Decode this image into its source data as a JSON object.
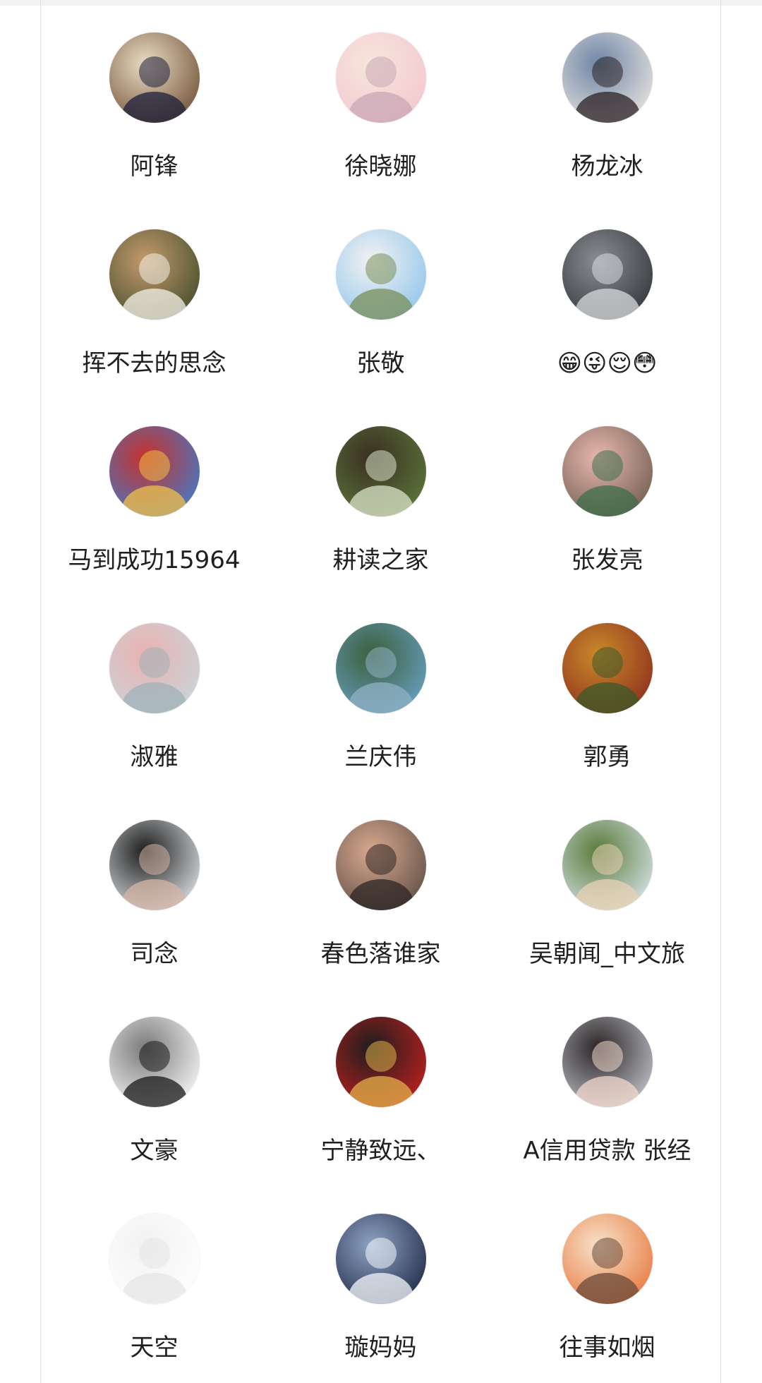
{
  "members": [
    {
      "name": "阿锋",
      "avatar_colors": [
        "#6b4a2e",
        "#e9dcc5",
        "#1d1f3b"
      ]
    },
    {
      "name": "徐晓娜",
      "avatar_colors": [
        "#f2c6cf",
        "#f7e6dc",
        "#c9a7b5"
      ]
    },
    {
      "name": "杨龙冰",
      "avatar_colors": [
        "#efe8e2",
        "#6e86a6",
        "#2c2226"
      ]
    },
    {
      "name": "挥不去的思念",
      "avatar_colors": [
        "#3e4a2a",
        "#c49a6c",
        "#f4f1e8"
      ]
    },
    {
      "name": "张敬",
      "avatar_colors": [
        "#8cc3ea",
        "#f2f2f2",
        "#7a8f5a"
      ]
    },
    {
      "name": "😁😜😌😳",
      "avatar_colors": [
        "#2f3338",
        "#8a8e92",
        "#d8dbde"
      ]
    },
    {
      "name": "马到成功15964",
      "avatar_colors": [
        "#3a7fd0",
        "#c7312c",
        "#f0c04a"
      ]
    },
    {
      "name": "耕读之家",
      "avatar_colors": [
        "#5e7a3c",
        "#3a2f22",
        "#d9e3c8"
      ]
    },
    {
      "name": "张发亮",
      "avatar_colors": [
        "#6b5a4a",
        "#e8b7b0",
        "#3e6f4a"
      ]
    },
    {
      "name": "淑雅",
      "avatar_colors": [
        "#c7d6dc",
        "#eab2b0",
        "#9fb1b8"
      ]
    },
    {
      "name": "兰庆伟",
      "avatar_colors": [
        "#6aa3c8",
        "#3c5f3c",
        "#8fb0c4"
      ]
    },
    {
      "name": "郭勇",
      "avatar_colors": [
        "#8a2a1c",
        "#c98a2a",
        "#3a5a2a"
      ]
    },
    {
      "name": "司念",
      "avatar_colors": [
        "#e8ecef",
        "#1c1c1c",
        "#d4b6a6"
      ]
    },
    {
      "name": "春色落谁家",
      "avatar_colors": [
        "#5a4b45",
        "#d9a98e",
        "#2e2624"
      ]
    },
    {
      "name": "吴朝闻_中文旅",
      "avatar_colors": [
        "#dce8f0",
        "#5a7a3a",
        "#e8d2b4"
      ]
    },
    {
      "name": "文豪",
      "avatar_colors": [
        "#ffffff",
        "#7a7a7a",
        "#1a1a1a"
      ]
    },
    {
      "name": "宁静致远、",
      "avatar_colors": [
        "#c8201e",
        "#1e1e1e",
        "#e2b04a"
      ]
    },
    {
      "name": "A信用贷款 张经",
      "avatar_colors": [
        "#c8ccd2",
        "#2a2325",
        "#f0d8cc"
      ]
    },
    {
      "name": "天空",
      "avatar_colors": [
        "#ffffff",
        "#f2f2f2",
        "#e6e6e6"
      ]
    },
    {
      "name": "璇妈妈",
      "avatar_colors": [
        "#1a2440",
        "#8fa3c4",
        "#f4f7fb"
      ]
    },
    {
      "name": "往事如烟",
      "avatar_colors": [
        "#e8743a",
        "#f6e2c9",
        "#6a4a3a"
      ]
    }
  ],
  "colors": {
    "text": "#1f1f1f",
    "background": "#ffffff",
    "divider": "#e1e1e1"
  }
}
